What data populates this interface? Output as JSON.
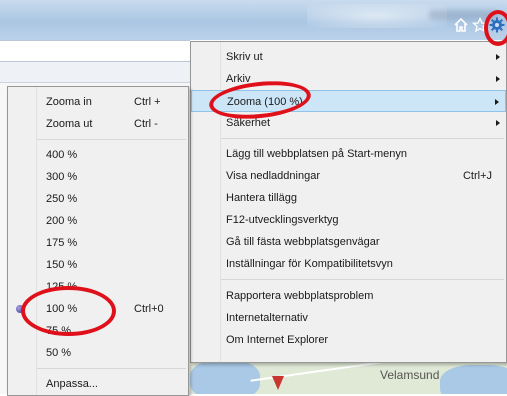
{
  "tools_menu": {
    "items": [
      {
        "label": "Skriv ut",
        "shortcut": "",
        "arrow": true
      },
      {
        "label": "Arkiv",
        "shortcut": "",
        "arrow": true
      },
      {
        "label": "Zooma (100 %)",
        "shortcut": "",
        "arrow": true,
        "highlighted": true
      },
      {
        "label": "Säkerhet",
        "shortcut": "",
        "arrow": true
      },
      {
        "label": "Lägg till webbplatsen på Start-menyn",
        "shortcut": ""
      },
      {
        "label": "Visa nedladdningar",
        "shortcut": "Ctrl+J"
      },
      {
        "label": "Hantera tillägg",
        "shortcut": ""
      },
      {
        "label": "F12-utvecklingsverktyg",
        "shortcut": ""
      },
      {
        "label": "Gå till fästa webbplatsgenvägar",
        "shortcut": ""
      },
      {
        "label": "Inställningar för Kompatibilitetsvyn",
        "shortcut": ""
      },
      {
        "label": "Rapportera webbplatsproblem",
        "shortcut": ""
      },
      {
        "label": "Internetalternativ",
        "shortcut": ""
      },
      {
        "label": "Om Internet Explorer",
        "shortcut": ""
      }
    ]
  },
  "zoom_menu": {
    "items": [
      {
        "label": "Zooma in",
        "shortcut": "Ctrl +"
      },
      {
        "label": "Zooma ut",
        "shortcut": "Ctrl -"
      },
      {
        "label": "400 %",
        "shortcut": ""
      },
      {
        "label": "300 %",
        "shortcut": ""
      },
      {
        "label": "250 %",
        "shortcut": ""
      },
      {
        "label": "200 %",
        "shortcut": ""
      },
      {
        "label": "175 %",
        "shortcut": ""
      },
      {
        "label": "150 %",
        "shortcut": ""
      },
      {
        "label": "125 %",
        "shortcut": ""
      },
      {
        "label": "100 %",
        "shortcut": "Ctrl+0",
        "selected": true
      },
      {
        "label": "75 %",
        "shortcut": ""
      },
      {
        "label": "50 %",
        "shortcut": ""
      },
      {
        "label": "Anpassa...",
        "shortcut": ""
      }
    ]
  },
  "map": {
    "place_label": "Velamsund"
  },
  "icons": {
    "home": "home-icon",
    "favorites": "star-icon",
    "tools": "gear-icon"
  },
  "colors": {
    "annotation": "#e0101a",
    "highlight": "#cde6f7",
    "menu_bg": "#f0f0f0"
  }
}
